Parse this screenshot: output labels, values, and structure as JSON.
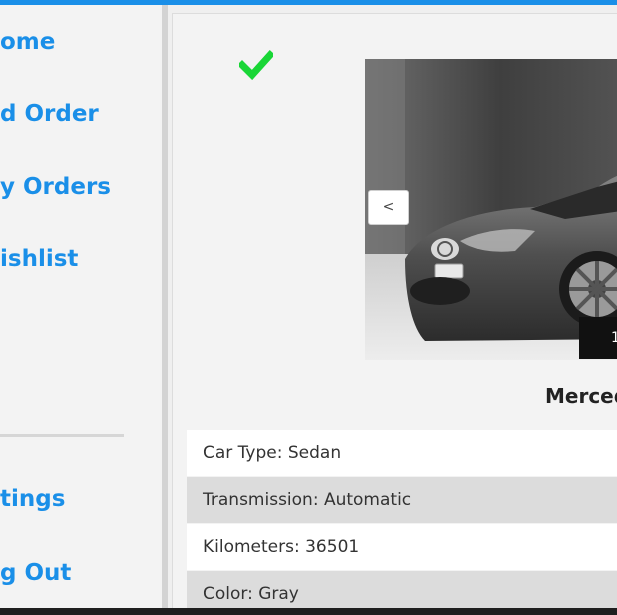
{
  "sidebar": {
    "items": [
      {
        "label": "ome"
      },
      {
        "label": "d Order"
      },
      {
        "label": "y Orders"
      },
      {
        "label": "ishlist"
      },
      {
        "label": "tings"
      },
      {
        "label": "g Out"
      }
    ]
  },
  "carousel": {
    "prev_label": "<",
    "counter": "1/"
  },
  "car": {
    "title": "Mercede",
    "specs": [
      {
        "text": "Car Type: Sedan"
      },
      {
        "text": "Transmission: Automatic"
      },
      {
        "text": "Kilometers: 36501"
      },
      {
        "text": "Color: Gray"
      }
    ]
  },
  "colors": {
    "accent": "#1a8fe8",
    "check": "#19d636"
  },
  "icons": [
    "check-icon"
  ]
}
